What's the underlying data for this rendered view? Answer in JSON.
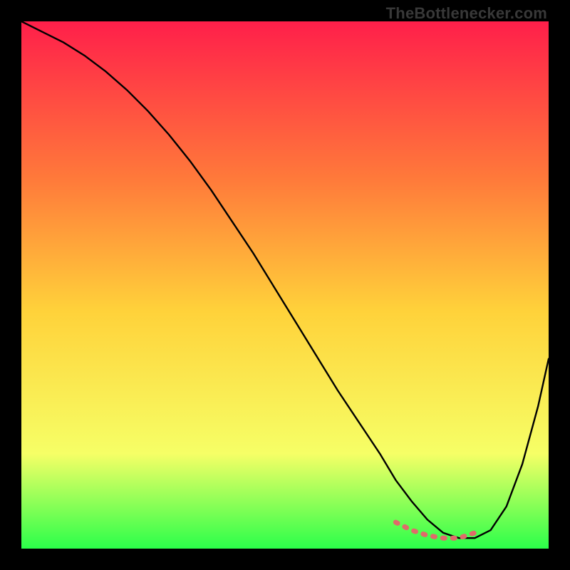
{
  "watermark": "TheBottlenecker.com",
  "colors": {
    "gradient_top": "#ff1f4a",
    "gradient_mid1": "#ff7a3a",
    "gradient_mid2": "#ffd23a",
    "gradient_mid3": "#f6ff66",
    "gradient_bottom": "#2bff4a",
    "curve": "#000000",
    "highlight": "#e06a6a",
    "frame": "#000000"
  },
  "chart_data": {
    "type": "line",
    "title": "",
    "xlabel": "",
    "ylabel": "",
    "xlim": [
      0,
      100
    ],
    "ylim": [
      0,
      100
    ],
    "grid": false,
    "series": [
      {
        "name": "bottleneck-curve",
        "x": [
          0,
          4,
          8,
          12,
          16,
          20,
          24,
          28,
          32,
          36,
          40,
          44,
          48,
          52,
          56,
          60,
          64,
          68,
          71,
          74,
          77,
          80,
          83,
          86,
          89,
          92,
          95,
          98,
          100
        ],
        "y": [
          100,
          98,
          96,
          93.5,
          90.5,
          87,
          83,
          78.5,
          73.5,
          68,
          62,
          56,
          49.5,
          43,
          36.5,
          30,
          24,
          18,
          13,
          9,
          5.5,
          3,
          2,
          2,
          3.5,
          8,
          16,
          27,
          36
        ]
      }
    ],
    "highlight_segment": {
      "name": "optimal-range",
      "x": [
        71,
        74,
        77,
        80,
        83,
        86
      ],
      "y": [
        5,
        3.5,
        2.5,
        2,
        2,
        3
      ]
    }
  }
}
